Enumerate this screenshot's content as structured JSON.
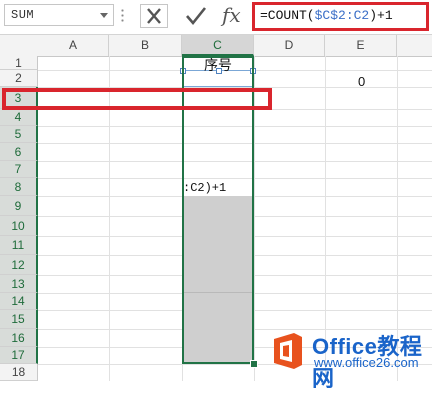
{
  "formula_bar": {
    "name_box": "SUM",
    "formula": {
      "prefix": "=COUNT(",
      "ref": "$C$2:C2",
      "suffix": ")+1"
    }
  },
  "columns": [
    "A",
    "B",
    "C",
    "D",
    "E"
  ],
  "rows": [
    "1",
    "2",
    "3",
    "4",
    "5",
    "6",
    "7",
    "8",
    "9",
    "10",
    "11",
    "12",
    "13",
    "14",
    "15",
    "16",
    "17",
    "18"
  ],
  "cells": {
    "C2": "序号",
    "E2": "0",
    "C8_partial": ":C2)+1"
  },
  "watermark": {
    "title": "Office教程网",
    "url": "www.office26.com"
  },
  "colors": {
    "excel_green": "#217346",
    "highlight_red": "#d9252d",
    "ref_blue": "#3b6fc7",
    "watermark_blue": "#1a64c9",
    "logo_orange": "#e8521e"
  }
}
